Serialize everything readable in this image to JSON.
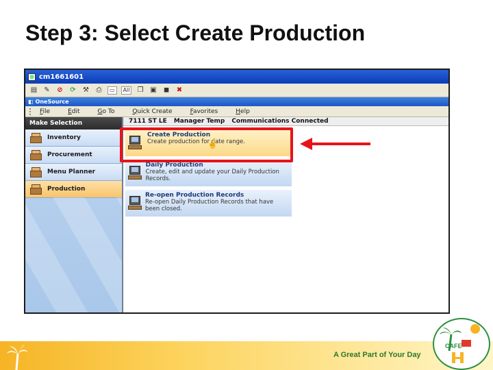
{
  "slide": {
    "title": "Step 3: Select Create Production",
    "tagline": "A Great Part of Your Day"
  },
  "window": {
    "title": "cm1661601"
  },
  "toolbar": {
    "all_label": "All"
  },
  "app_bar": {
    "label": "OneSource"
  },
  "menu": [
    "File",
    "Edit",
    "Go To",
    "Quick Create",
    "Favorites",
    "Help"
  ],
  "left_panel": {
    "header": "Make Selection",
    "items": [
      {
        "label": "Inventory",
        "active": false
      },
      {
        "label": "Procurement",
        "active": false
      },
      {
        "label": "Menu Planner",
        "active": false
      },
      {
        "label": "Production",
        "active": true
      }
    ]
  },
  "status_bar": [
    "7111 ST LE",
    "Manager Temp",
    "Communications Connected"
  ],
  "cards": [
    {
      "title": "Create Production",
      "desc": "Create production for date range.",
      "highlighted": true
    },
    {
      "title": "Daily Production",
      "desc": "Create, edit and update your Daily Production Records.",
      "highlighted": false
    },
    {
      "title": "Re-open Production Records",
      "desc": "Re-open Daily Production Records that have been closed.",
      "highlighted": false
    }
  ],
  "logo": {
    "text": "CAFE"
  },
  "colors": {
    "highlight_box": "#e8131a",
    "nav_active": "#f8c46a",
    "footer": "#f6b425"
  }
}
